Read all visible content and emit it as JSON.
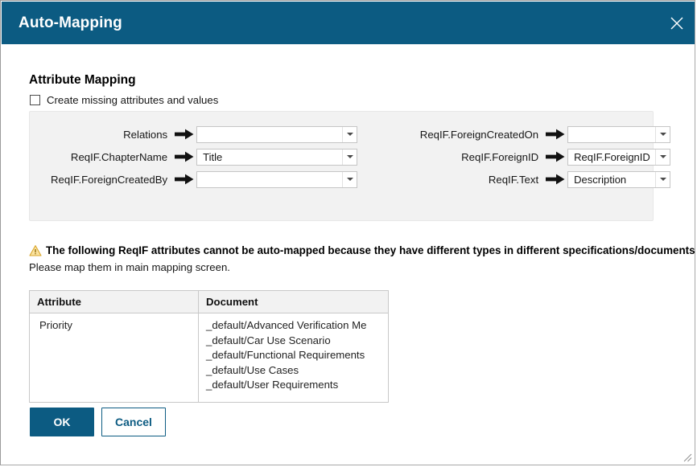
{
  "window": {
    "title": "Auto-Mapping",
    "close_icon": "close-icon",
    "resize_grip_icon": "resize-grip-icon",
    "title_bar_color": "#0c5b82"
  },
  "section": {
    "heading": "Attribute Mapping",
    "checkbox": {
      "label": "Create missing attributes and values",
      "checked": false
    }
  },
  "mapping": {
    "arrow_icon": "right-arrow-icon",
    "dropdown_icon": "chevron-down-icon",
    "left_column": [
      {
        "source": "Relations",
        "target": ""
      },
      {
        "source": "ReqIF.ChapterName",
        "target": "Title"
      },
      {
        "source": "ReqIF.ForeignCreatedBy",
        "target": ""
      }
    ],
    "right_column": [
      {
        "source": "ReqIF.ForeignCreatedOn",
        "target": ""
      },
      {
        "source": "ReqIF.ForeignID",
        "target": "ReqIF.ForeignID"
      },
      {
        "source": "ReqIF.Text",
        "target": "Description"
      }
    ]
  },
  "warning": {
    "icon": "warning-triangle-icon",
    "line1": "The following ReqIF attributes cannot be auto-mapped because they have different types in different specifications/documents:",
    "line2": "Please map them in main mapping screen.",
    "icon_color": "#e8b33c"
  },
  "table": {
    "columns": [
      "Attribute",
      "Document"
    ],
    "rows": [
      {
        "attribute": "Priority",
        "documents": [
          "_default/Advanced Verification Me",
          "_default/Car Use Scenario",
          "_default/Functional Requirements",
          "_default/Use Cases",
          "_default/User Requirements"
        ]
      }
    ]
  },
  "buttons": {
    "ok": "OK",
    "cancel": "Cancel",
    "accent_color": "#0c5b82"
  }
}
